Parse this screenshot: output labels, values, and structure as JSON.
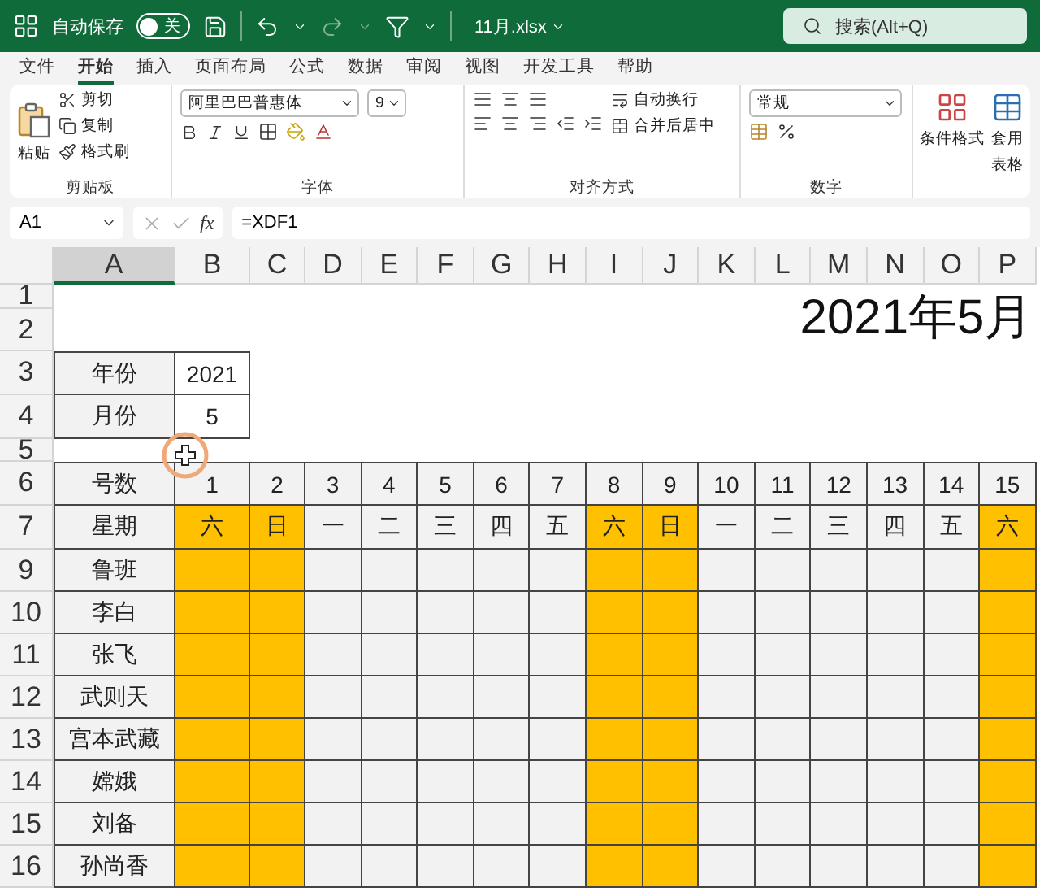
{
  "title_bar": {
    "autosave_label": "自动保存",
    "autosave_state": "关",
    "autosave_on": false,
    "filename": "11月.xlsx",
    "search_placeholder": "搜索(Alt+Q)"
  },
  "menu_tabs": [
    {
      "label": "文件",
      "selected": false
    },
    {
      "label": "开始",
      "selected": true
    },
    {
      "label": "插入",
      "selected": false
    },
    {
      "label": "页面布局",
      "selected": false
    },
    {
      "label": "公式",
      "selected": false
    },
    {
      "label": "数据",
      "selected": false
    },
    {
      "label": "审阅",
      "selected": false
    },
    {
      "label": "视图",
      "selected": false
    },
    {
      "label": "开发工具",
      "selected": false
    },
    {
      "label": "帮助",
      "selected": false
    }
  ],
  "ribbon": {
    "clipboard": {
      "paste": "粘贴",
      "cut": "剪切",
      "copy": "复制",
      "format_painter": "格式刷",
      "label": "剪贴板"
    },
    "font": {
      "name": "阿里巴巴普惠体",
      "size": "9",
      "label": "字体"
    },
    "alignment": {
      "wrap": "自动换行",
      "merge": "合并后居中",
      "label": "对齐方式"
    },
    "number": {
      "format": "常规",
      "label": "数字"
    },
    "styles": {
      "conditional": "条件格式",
      "table_line1": "套用",
      "table_line2": "表格"
    }
  },
  "formula_bar": {
    "name_box": "A1",
    "formula": "=XDF1",
    "function_label": "fx"
  },
  "columns": [
    {
      "letter": "A",
      "selected": true
    },
    {
      "letter": "B",
      "selected": false
    },
    {
      "letter": "C",
      "selected": false
    },
    {
      "letter": "D",
      "selected": false
    },
    {
      "letter": "E",
      "selected": false
    },
    {
      "letter": "F",
      "selected": false
    },
    {
      "letter": "G",
      "selected": false
    },
    {
      "letter": "H",
      "selected": false
    },
    {
      "letter": "I",
      "selected": false
    },
    {
      "letter": "J",
      "selected": false
    },
    {
      "letter": "K",
      "selected": false
    },
    {
      "letter": "L",
      "selected": false
    },
    {
      "letter": "M",
      "selected": false
    },
    {
      "letter": "N",
      "selected": false
    },
    {
      "letter": "O",
      "selected": false
    },
    {
      "letter": "P",
      "selected": false
    }
  ],
  "sheet_title": "2021年5月",
  "days": [
    {
      "number": "1",
      "weekday": "六",
      "weekend": true
    },
    {
      "number": "2",
      "weekday": "日",
      "weekend": true
    },
    {
      "number": "3",
      "weekday": "一",
      "weekend": false
    },
    {
      "number": "4",
      "weekday": "二",
      "weekend": false
    },
    {
      "number": "5",
      "weekday": "三",
      "weekend": false
    },
    {
      "number": "6",
      "weekday": "四",
      "weekend": false
    },
    {
      "number": "7",
      "weekday": "五",
      "weekend": false
    },
    {
      "number": "8",
      "weekday": "六",
      "weekend": true
    },
    {
      "number": "9",
      "weekday": "日",
      "weekend": true
    },
    {
      "number": "10",
      "weekday": "一",
      "weekend": false
    },
    {
      "number": "11",
      "weekday": "二",
      "weekend": false
    },
    {
      "number": "12",
      "weekday": "三",
      "weekend": false
    },
    {
      "number": "13",
      "weekday": "四",
      "weekend": false
    },
    {
      "number": "14",
      "weekday": "五",
      "weekend": false
    },
    {
      "number": "15",
      "weekday": "六",
      "weekend": true
    }
  ],
  "rows": [
    {
      "header": "1",
      "kind": "blank"
    },
    {
      "header": "2",
      "kind": "blank"
    },
    {
      "header": "3",
      "kind": "field",
      "label": "年份",
      "value": "2021"
    },
    {
      "header": "4",
      "kind": "field",
      "label": "月份",
      "value": "5"
    },
    {
      "header": "5",
      "kind": "blank"
    },
    {
      "header": "6",
      "kind": "days",
      "label": "号数"
    },
    {
      "header": "7",
      "kind": "weekdays",
      "label": "星期"
    },
    {
      "header": "9",
      "kind": "person",
      "label": "鲁班"
    },
    {
      "header": "10",
      "kind": "person",
      "label": "李白"
    },
    {
      "header": "11",
      "kind": "person",
      "label": "张飞"
    },
    {
      "header": "12",
      "kind": "person",
      "label": "武则天"
    },
    {
      "header": "13",
      "kind": "person",
      "label": "宫本武藏"
    },
    {
      "header": "14",
      "kind": "person",
      "label": "嫦娥"
    },
    {
      "header": "15",
      "kind": "person",
      "label": "刘备"
    },
    {
      "header": "16",
      "kind": "person",
      "label": "孙尚香"
    }
  ]
}
